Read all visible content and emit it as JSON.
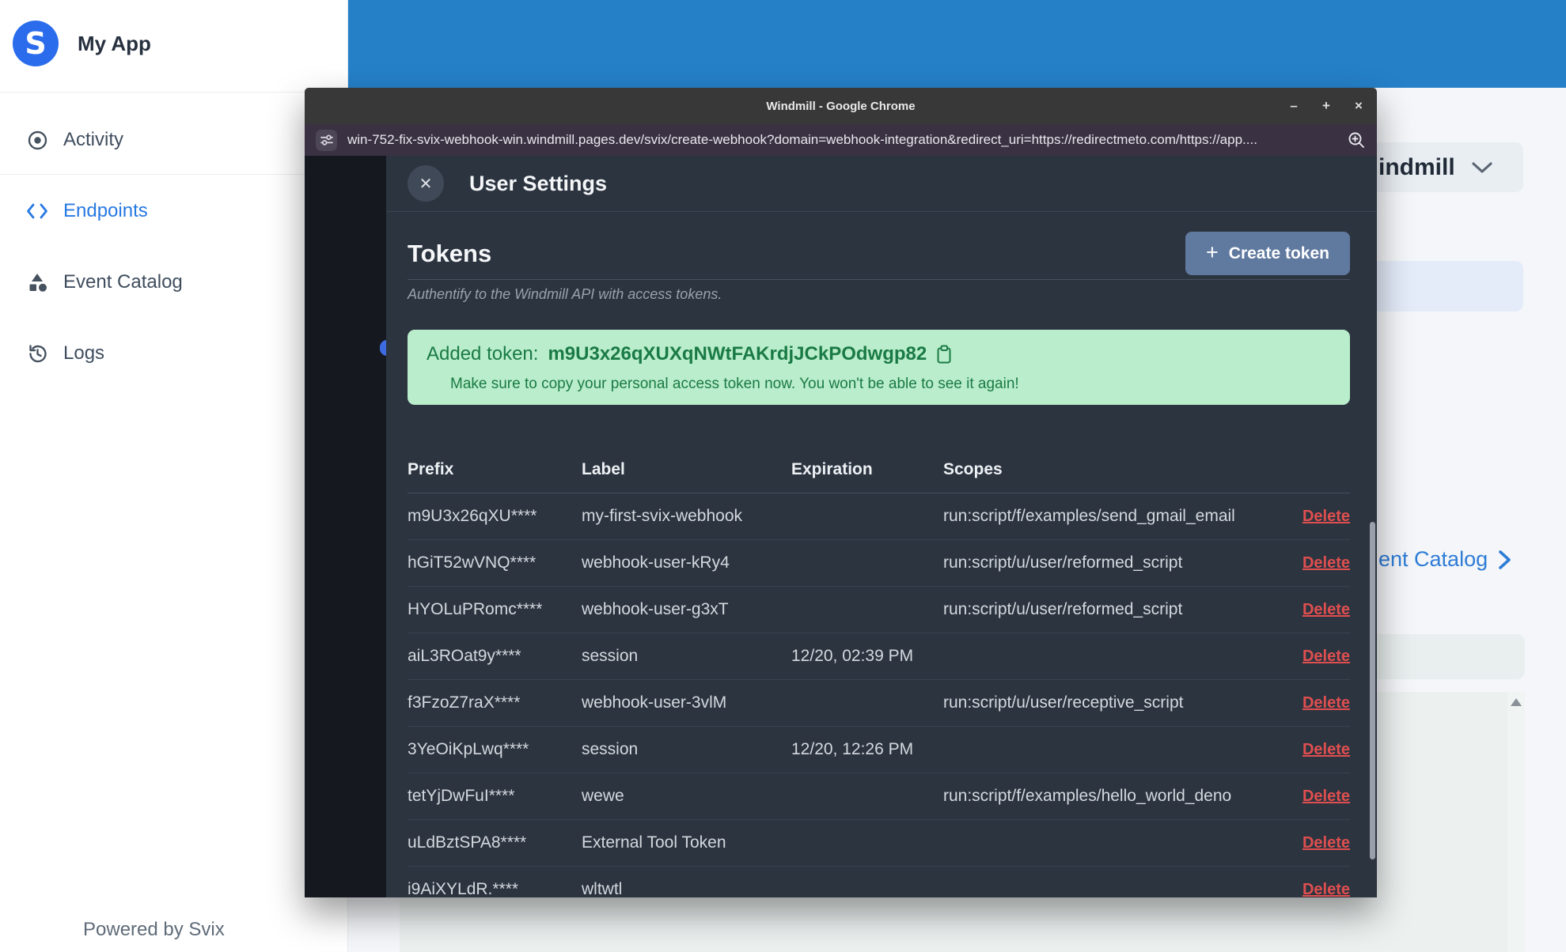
{
  "svix_app": {
    "brand": "My App",
    "sidebar_items": [
      {
        "label": "Activity",
        "icon": "disc-icon",
        "active": false
      },
      {
        "label": "Endpoints",
        "icon": "code-brackets-icon",
        "active": true
      },
      {
        "label": "Event Catalog",
        "icon": "shapes-icon",
        "active": false
      },
      {
        "label": "Logs",
        "icon": "history-icon",
        "active": false
      }
    ],
    "footer": "Powered by Svix",
    "topbar_icons": [
      "dark-mode-moon",
      "help",
      "account"
    ],
    "help_glyph": "?"
  },
  "background_page": {
    "workspace_dropdown_visible_text": "indmill",
    "catalog_link_visible_text": "ent Catalog"
  },
  "chrome_window": {
    "title": "Windmill - Google Chrome",
    "url": "win-752-fix-svix-webhook-win.windmill.pages.dev/svix/create-webhook?domain=webhook-integration&redirect_uri=https://redirectmeto.com/https://app....",
    "controls": {
      "minimize": "–",
      "maximize": "+",
      "close": "×"
    }
  },
  "modal": {
    "close_glyph": "✕",
    "title": "User Settings",
    "section_title": "Tokens",
    "section_subtitle": "Authentify to the Windmill API with access tokens.",
    "create_button": {
      "icon": "+",
      "label": "Create token"
    },
    "banner": {
      "lead": "Added token:",
      "token": "m9U3x26qXUXqNWtFAKrdjJCkPOdwgp82",
      "note": "Make sure to copy your personal access token now. You won't be able to see it again!"
    },
    "table": {
      "headers": [
        "Prefix",
        "Label",
        "Expiration",
        "Scopes"
      ],
      "delete_label": "Delete",
      "rows": [
        {
          "prefix": "m9U3x26qXU****",
          "label": "my-first-svix-webhook",
          "expiration": "",
          "scopes": "run:script/f/examples/send_gmail_email"
        },
        {
          "prefix": "hGiT52wVNQ****",
          "label": "webhook-user-kRy4",
          "expiration": "",
          "scopes": "run:script/u/user/reformed_script"
        },
        {
          "prefix": "HYOLuPRomc****",
          "label": "webhook-user-g3xT",
          "expiration": "",
          "scopes": "run:script/u/user/reformed_script"
        },
        {
          "prefix": "aiL3ROat9y****",
          "label": "session",
          "expiration": "12/20, 02:39 PM",
          "scopes": ""
        },
        {
          "prefix": "f3FzoZ7raX****",
          "label": "webhook-user-3vlM",
          "expiration": "",
          "scopes": "run:script/u/user/receptive_script"
        },
        {
          "prefix": "3YeOiKpLwq****",
          "label": "session",
          "expiration": "12/20, 12:26 PM",
          "scopes": ""
        },
        {
          "prefix": "tetYjDwFuI****",
          "label": "wewe",
          "expiration": "",
          "scopes": "run:script/f/examples/hello_world_deno"
        },
        {
          "prefix": "uLdBztSPA8****",
          "label": "External Tool Token",
          "expiration": "",
          "scopes": ""
        },
        {
          "prefix": "i9AiXYLdR.****",
          "label": "wltwtl",
          "expiration": "",
          "scopes": ""
        }
      ]
    }
  },
  "colors": {
    "topbar_blue": "#2580c8",
    "accent_blue": "#2779e2",
    "success_bg": "#b9edcb",
    "success_text": "#1a7a45",
    "delete_red": "#e04f4f",
    "drawer_bg": "#2c3440"
  }
}
